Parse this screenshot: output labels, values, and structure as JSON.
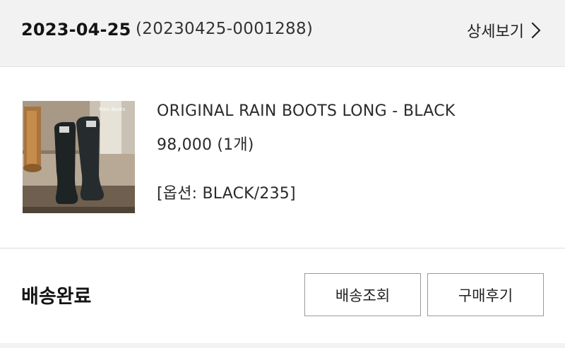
{
  "order": {
    "date": "2023-04-25",
    "number": "(20230425-0001288)",
    "detail_link": "상세보기"
  },
  "product": {
    "image_icon": "rain-boots-photo",
    "name": "ORIGINAL RAIN BOOTS LONG - BLACK",
    "price": "98,000 (1개)",
    "option": "[옵션: BLACK/235]"
  },
  "status": {
    "label": "배송완료",
    "track_button": "배송조회",
    "review_button": "구매후기"
  },
  "colors": {
    "header_bg": "#f2f2f2",
    "text": "#1a1a1a",
    "button_border": "#9a9a9a"
  }
}
